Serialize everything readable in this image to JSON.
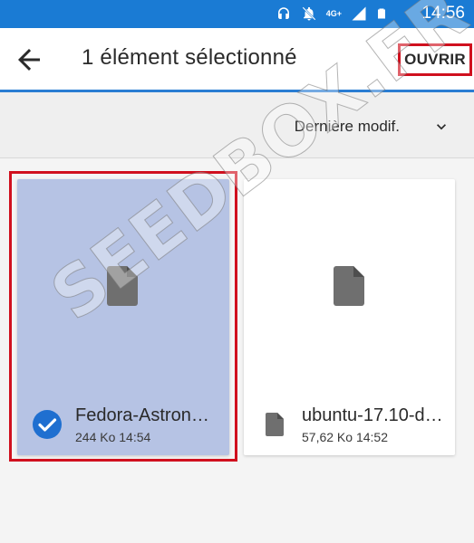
{
  "status_bar": {
    "network": "4G+",
    "time": "14:56"
  },
  "app_bar": {
    "title": "1 élément sélectionné",
    "open_label": "OUVRIR"
  },
  "sort_bar": {
    "label": "Dernière modif."
  },
  "files": [
    {
      "name": "Fedora-Astrono…",
      "size": "244 Ko",
      "time": "14:54",
      "selected": true
    },
    {
      "name": "ubuntu-17.10-d…",
      "size": "57,62 Ko",
      "time": "14:52",
      "selected": false
    }
  ],
  "watermark": "SEEDBOX.FR",
  "colors": {
    "status_bar_bg": "#1a7bd4",
    "selected_card_bg": "#b6c3e4",
    "check_blue": "#1f6fd0",
    "highlight_red": "#d0101e"
  }
}
